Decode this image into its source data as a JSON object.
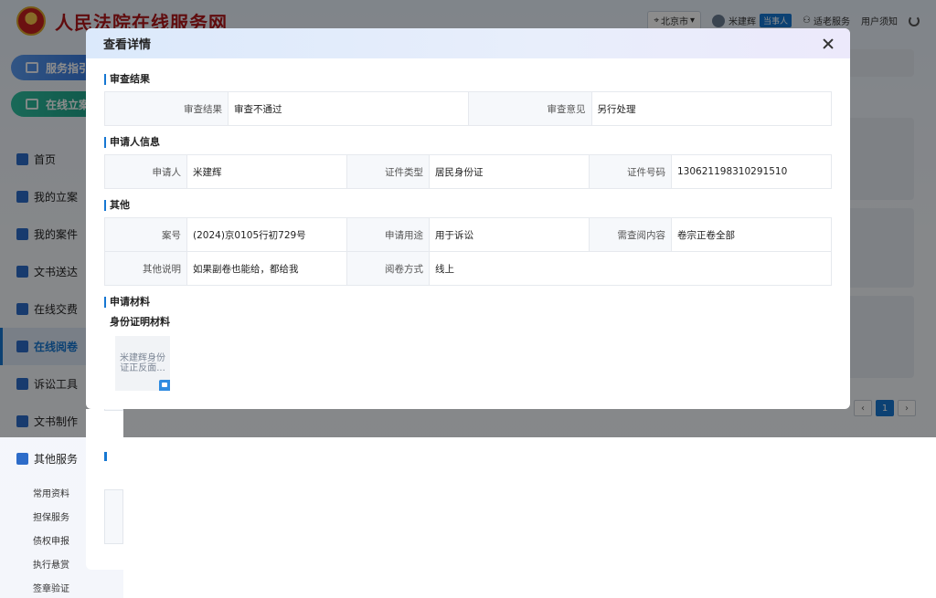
{
  "site": {
    "title": "人民法院在线服务网"
  },
  "topbar": {
    "city": "北京市",
    "user_name": "米建辉",
    "role_badge": "当事人",
    "elderly_service": "适老服务",
    "user_notice": "用户须知"
  },
  "sidebar": {
    "guide_label": "服务指引",
    "filing_label": "在线立案",
    "items": [
      {
        "label": "首页"
      },
      {
        "label": "我的立案"
      },
      {
        "label": "我的案件"
      },
      {
        "label": "文书送达"
      },
      {
        "label": "在线交费"
      },
      {
        "label": "在线阅卷"
      },
      {
        "label": "诉讼工具"
      },
      {
        "label": "文书制作"
      },
      {
        "label": "其他服务"
      }
    ],
    "sub_items": [
      {
        "label": "常用资料"
      },
      {
        "label": "担保服务"
      },
      {
        "label": "债权申报"
      },
      {
        "label": "执行悬赏"
      },
      {
        "label": "签章验证"
      }
    ]
  },
  "pager": {
    "current": "1"
  },
  "modal": {
    "title": "查看详情",
    "sections": {
      "review": {
        "title": "审查结果",
        "result_label": "审查结果",
        "result_value": "审查不通过",
        "opinion_label": "审查意见",
        "opinion_value": "另行处理"
      },
      "applicant": {
        "title": "申请人信息",
        "name_label": "申请人",
        "name_value": "米建辉",
        "id_type_label": "证件类型",
        "id_type_value": "居民身份证",
        "id_no_label": "证件号码",
        "id_no_value": "130621198310291510"
      },
      "other": {
        "title": "其他",
        "case_no_label": "案号",
        "case_no_value": "(2024)京0105行初729号",
        "purpose_label": "申请用途",
        "purpose_value": "用于诉讼",
        "content_label": "需查阅内容",
        "content_value": "卷宗正卷全部",
        "note_label": "其他说明",
        "note_value": "如果副卷也能给，都给我",
        "method_label": "阅卷方式",
        "method_value": "线上"
      },
      "materials": {
        "title": "申请材料",
        "subtitle": "身份证明材料",
        "file_name": "米建辉身份证正反面..."
      }
    }
  }
}
